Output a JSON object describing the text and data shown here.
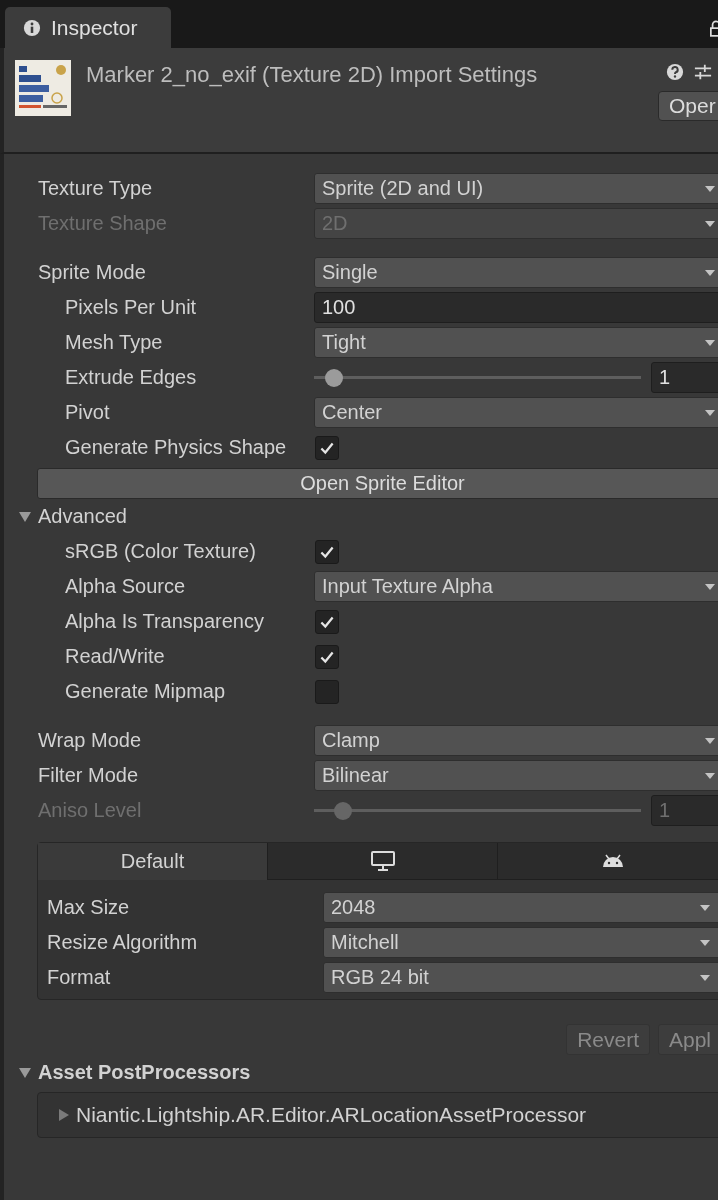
{
  "inspector_tab": {
    "label": "Inspector",
    "selected": true
  },
  "header": {
    "title": "Marker 2_no_exif (Texture 2D) Import Settings",
    "open_button": "Oper"
  },
  "groups": [
    {
      "items": [
        {
          "kind": "dropdown",
          "label": "Texture Type",
          "value": "Sprite (2D and UI)",
          "disabled": false
        },
        {
          "kind": "dropdown",
          "label": "Texture Shape",
          "value": "2D",
          "disabled": true
        }
      ]
    },
    {
      "items": [
        {
          "kind": "dropdown",
          "label": "Sprite Mode",
          "value": "Single",
          "disabled": false,
          "children": [
            {
              "kind": "text",
              "label": "Pixels Per Unit",
              "value": "100",
              "disabled": false
            },
            {
              "kind": "dropdown",
              "label": "Mesh Type",
              "value": "Tight",
              "disabled": false
            },
            {
              "kind": "slider",
              "label": "Extrude Edges",
              "value": "1",
              "level": 0.06,
              "disabled": false
            },
            {
              "kind": "dropdown",
              "label": "Pivot",
              "value": "Center",
              "disabled": false
            },
            {
              "kind": "checkbox",
              "label": "Generate Physics Shape",
              "checked": true,
              "disabled": false
            }
          ]
        },
        {
          "kind": "button",
          "label": "Open Sprite Editor"
        },
        {
          "kind": "foldout",
          "label": "Advanced",
          "expanded": true,
          "children": [
            {
              "kind": "checkbox",
              "label": "sRGB (Color Texture)",
              "checked": true,
              "disabled": false
            },
            {
              "kind": "dropdown",
              "label": "Alpha Source",
              "value": "Input Texture Alpha",
              "disabled": false
            },
            {
              "kind": "checkbox",
              "label": "Alpha Is Transparency",
              "checked": true,
              "disabled": false
            },
            {
              "kind": "checkbox",
              "label": "Read/Write",
              "checked": true,
              "disabled": false
            },
            {
              "kind": "checkbox",
              "label": "Generate Mipmap",
              "checked": false,
              "disabled": false
            }
          ]
        }
      ]
    },
    {
      "items": [
        {
          "kind": "dropdown",
          "label": "Wrap Mode",
          "value": "Clamp",
          "disabled": false
        },
        {
          "kind": "dropdown",
          "label": "Filter Mode",
          "value": "Bilinear",
          "disabled": false
        },
        {
          "kind": "slider",
          "label": "Aniso Level",
          "value": "1",
          "level": 0.09,
          "disabled": true
        }
      ]
    }
  ],
  "platform_tabs": [
    {
      "kind": "text",
      "label": "Default",
      "selected": true
    },
    {
      "kind": "monitor",
      "selected": false
    },
    {
      "kind": "android",
      "selected": false
    }
  ],
  "platform_rows": [
    {
      "label": "Max Size",
      "value": "2048"
    },
    {
      "label": "Resize Algorithm",
      "value": "Mitchell"
    },
    {
      "label": "Format",
      "value": "RGB 24 bit"
    }
  ],
  "buttons": [
    {
      "label": "Revert",
      "disabled": true
    },
    {
      "label": "Appl",
      "disabled": true
    }
  ],
  "asset_postprocessors": {
    "label": "Asset PostProcessors",
    "expanded": true,
    "items": [
      {
        "label": "Niantic.Lightship.AR.Editor.ARLocationAssetProcessor",
        "expanded": false
      }
    ]
  }
}
